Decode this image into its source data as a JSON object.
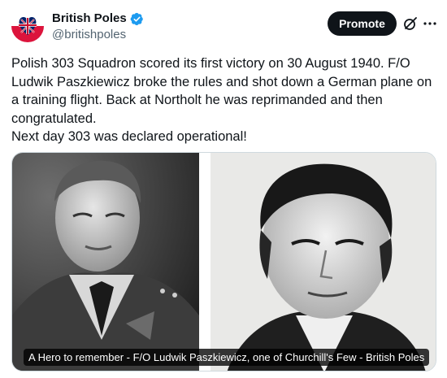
{
  "account": {
    "display_name": "British Poles",
    "handle": "@britishpoles",
    "verified": true,
    "avatar_icon": "polish-british-flag-heart-avatar"
  },
  "actions": {
    "promote_label": "Promote",
    "grok_icon": "grok-icon",
    "more_icon": "more-icon"
  },
  "tweet": {
    "lines": [
      "Polish 303 Squadron scored its first victory on 30 August 1940. F/O Ludwik Paszkiewicz broke the rules and shot down a German plane on a training flight. Back at Northolt he was reprimanded and then congratulated.",
      "Next day 303 was declared operational!"
    ]
  },
  "media": {
    "caption": "A Hero to remember - F/O Ludwik Paszkiewicz, one of Churchill's Few - British Poles"
  },
  "colors": {
    "brand_text": "#0f1419",
    "secondary_text": "#536471",
    "verified_blue": "#1d9bf0"
  }
}
